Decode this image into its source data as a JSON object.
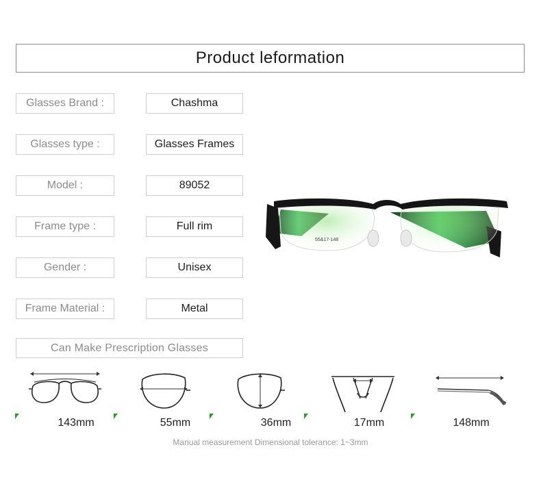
{
  "header": {
    "title": "Product leformation"
  },
  "specs": [
    {
      "label": "Glasses Brand :",
      "value": "Chashma"
    },
    {
      "label": "Glasses type :",
      "value": "Glasses Frames"
    },
    {
      "label": "Model :",
      "value": "89052"
    },
    {
      "label": "Frame type :",
      "value": "Full rim"
    },
    {
      "label": "Gender :",
      "value": "Unisex"
    },
    {
      "label": "Frame Material :",
      "value": "Metal"
    }
  ],
  "prescription": {
    "label": "Can Make Prescription Glasses"
  },
  "product": {
    "temple_print": "55&17-148"
  },
  "measurements": [
    {
      "value": "143mm",
      "icon": "frame-width-icon"
    },
    {
      "value": "55mm",
      "icon": "lens-width-icon"
    },
    {
      "value": "36mm",
      "icon": "lens-height-icon"
    },
    {
      "value": "17mm",
      "icon": "bridge-width-icon"
    },
    {
      "value": "148mm",
      "icon": "temple-length-icon"
    }
  ],
  "tolerance_note": "Manual measurement Dimensional tolerance: 1~3mm",
  "colors": {
    "accent_green": "#2e9a2e",
    "border": "#cfcfcf",
    "label_text": "#8c8c8c"
  }
}
